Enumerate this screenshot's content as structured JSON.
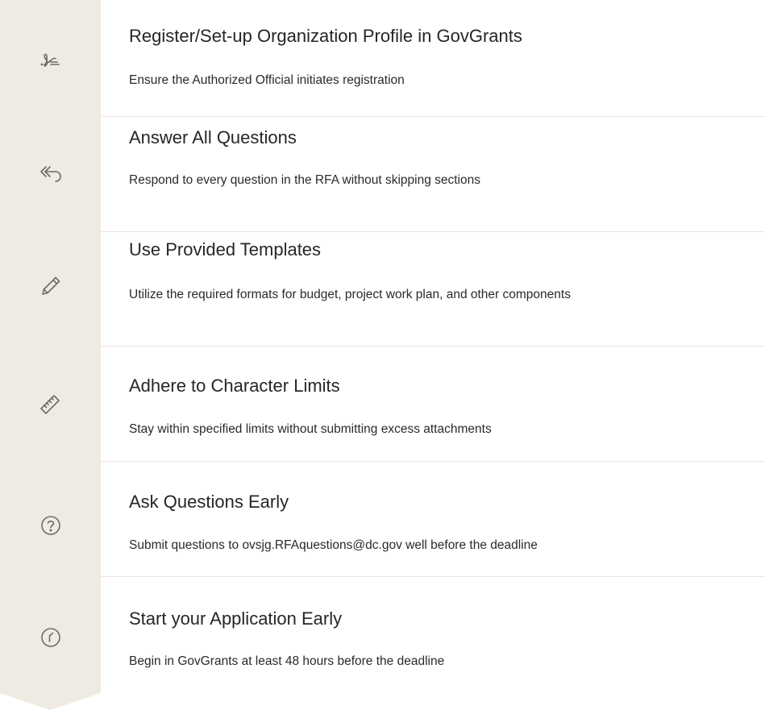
{
  "accent_color": "#efebe2",
  "steps": [
    {
      "icon": "signature-icon",
      "title": "Register/Set-up Organization Profile in GovGrants",
      "description": "Ensure the Authorized Official initiates registration"
    },
    {
      "icon": "reply-all-icon",
      "title": "Answer All Questions",
      "description": "Respond to every question in the RFA without skipping sections"
    },
    {
      "icon": "pencil-icon",
      "title": "Use Provided Templates",
      "description": "Utilize the required formats for budget, project work plan, and other components"
    },
    {
      "icon": "ruler-icon",
      "title": "Adhere to Character Limits",
      "description": "Stay within specified limits without submitting excess attachments"
    },
    {
      "icon": "question-circle-icon",
      "title": "Ask Questions Early",
      "description": "Submit questions to ovsjg.RFAquestions@dc.gov well before the deadline"
    },
    {
      "icon": "clock-icon",
      "title": "Start your Application Early",
      "description": "Begin in GovGrants at least 48 hours before the deadline"
    }
  ]
}
